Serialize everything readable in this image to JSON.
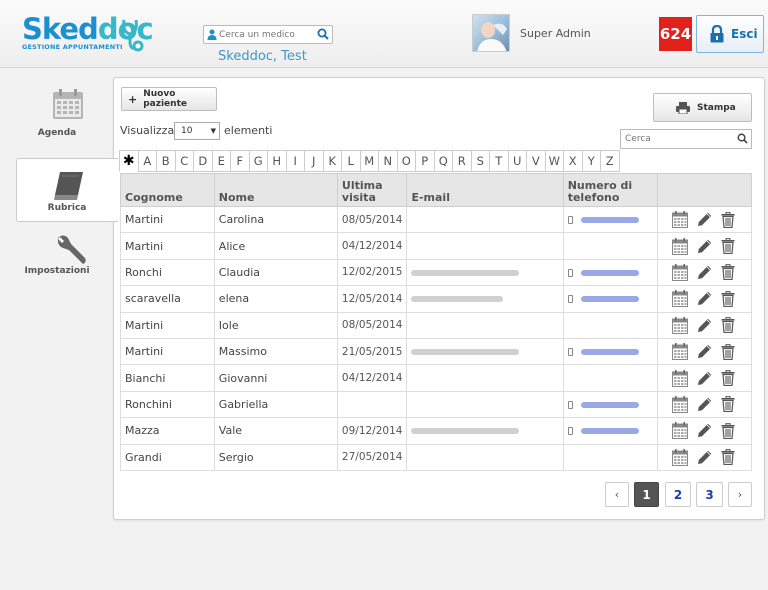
{
  "header": {
    "logo_part1": "Sked",
    "logo_part2": "doc",
    "logo_sub": "GESTIONE APPUNTAMENTI",
    "search_placeholder": "Cerca un medico",
    "subtitle": "Skeddoc, Test",
    "user_name": "Super Admin",
    "badge_count": "624",
    "logout_label": "Esci"
  },
  "sidebar": {
    "items": [
      {
        "label": "Agenda",
        "icon": "calendar-icon",
        "active": false
      },
      {
        "label": "Rubrica",
        "icon": "address-book-icon",
        "active": true
      },
      {
        "label": "Impostazioni",
        "icon": "wrench-icon",
        "active": false
      }
    ]
  },
  "toolbar": {
    "new_patient_label": "Nuovo paziente",
    "print_label": "Stampa",
    "show_label": "Visualizza",
    "page_size": "10",
    "elements_label": "elementi",
    "search_placeholder": "Cerca"
  },
  "letters": [
    "✱",
    "A",
    "B",
    "C",
    "D",
    "E",
    "F",
    "G",
    "H",
    "I",
    "J",
    "K",
    "L",
    "M",
    "N",
    "O",
    "P",
    "Q",
    "R",
    "S",
    "T",
    "U",
    "V",
    "W",
    "X",
    "Y",
    "Z"
  ],
  "table": {
    "headers": {
      "surname": "Cognome",
      "name": "Nome",
      "last_visit_1": "Ultima",
      "last_visit_2": "visita",
      "email": "E-mail",
      "phone_1": "Numero di",
      "phone_2": "telefono"
    },
    "rows": [
      {
        "surname": "Martini",
        "name": "Carolina",
        "date": "08/05/2014",
        "email": false,
        "phone": true
      },
      {
        "surname": "Martini",
        "name": "Alice",
        "date": "04/12/2014",
        "email": false,
        "phone": false
      },
      {
        "surname": "Ronchi",
        "name": "Claudia",
        "date": "12/02/2015",
        "email": true,
        "phone": true
      },
      {
        "surname": "scaravella",
        "name": "elena",
        "date": "12/05/2014",
        "email": true,
        "phone": true
      },
      {
        "surname": "Martini",
        "name": "Iole",
        "date": "08/05/2014",
        "email": false,
        "phone": false
      },
      {
        "surname": "Martini",
        "name": "Massimo",
        "date": "21/05/2015",
        "email": true,
        "phone": true
      },
      {
        "surname": "Bianchi",
        "name": "Giovanni",
        "date": "04/12/2014",
        "email": false,
        "phone": false
      },
      {
        "surname": "Ronchini",
        "name": "Gabriella",
        "date": "",
        "email": false,
        "phone": true
      },
      {
        "surname": "Mazza",
        "name": "Vale",
        "date": "09/12/2014",
        "email": true,
        "phone": true
      },
      {
        "surname": "Grandi",
        "name": "Sergio",
        "date": "27/05/2014",
        "email": false,
        "phone": false
      }
    ]
  },
  "pagination": {
    "prev": "‹",
    "pages": [
      "1",
      "2",
      "3"
    ],
    "current": "1",
    "next": "›"
  },
  "colors": {
    "brand_blue": "#1b8fcf",
    "brand_teal": "#36b8c8",
    "badge_red": "#e3211b"
  }
}
